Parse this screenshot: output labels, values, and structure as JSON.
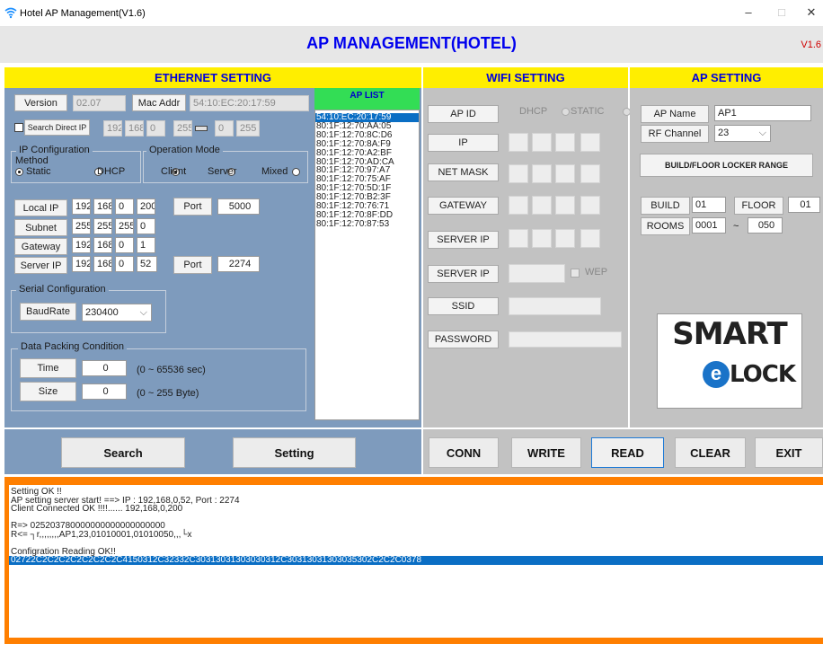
{
  "window": {
    "title": "Hotel AP Management(V1.6)",
    "minimize": "–",
    "maximize": "□",
    "close": "✕"
  },
  "header": {
    "title": "AP MANAGEMENT(HOTEL)",
    "version": "V1.6"
  },
  "ethernet": {
    "heading": "ETHERNET SETTING",
    "version_label": "Version",
    "version_value": "02.07",
    "mac_label": "Mac Addr",
    "mac_value": "54:10:EC:20:17:59",
    "search_direct_ip_label": "Search Direct IP",
    "direct_ip": [
      "192",
      "168",
      "0",
      "255",
      "0",
      "255"
    ],
    "ip_config_group": "IP Configuration",
    "method_label": "Method",
    "method_static": "Static",
    "method_dhcp": "DHCP",
    "op_mode_group": "Operation Mode",
    "mode_client": "Client",
    "mode_server": "Server",
    "mode_mixed": "Mixed",
    "local_ip_label": "Local IP",
    "local_ip": [
      "192",
      "168",
      "0",
      "200"
    ],
    "port_label": "Port",
    "local_port": "5000",
    "subnet_label": "Subnet",
    "subnet": [
      "255",
      "255",
      "255",
      "0"
    ],
    "gateway_label": "Gateway",
    "gateway": [
      "192",
      "168",
      "0",
      "1"
    ],
    "server_ip_label": "Server IP",
    "server_ip": [
      "192",
      "168",
      "0",
      "52"
    ],
    "server_port_label": "Port",
    "server_port": "2274",
    "serial_group": "Serial Configuration",
    "baudrate_label": "BaudRate",
    "baudrate_value": "230400",
    "packing_group": "Data Packing Condition",
    "time_label": "Time",
    "time_value": "0",
    "time_range": "(0 ~ 65536 sec)",
    "size_label": "Size",
    "size_value": "0",
    "size_range": "(0 ~ 255 Byte)",
    "search_button": "Search",
    "setting_button": "Setting"
  },
  "ap_list": {
    "heading": "AP LIST",
    "items": [
      "54:10:EC:20:17:59",
      "80:1F:12:70:AA:05",
      "80:1F:12:70:8C:D6",
      "80:1F:12:70:8A:F9",
      "80:1F:12:70:A2:BF",
      "80:1F:12:70:AD:CA",
      "80:1F:12:70:97:A7",
      "80:1F:12:70:75:AF",
      "80:1F:12:70:5D:1F",
      "80:1F:12:70:B2:3F",
      "80:1F:12:70:76:71",
      "80:1F:12:70:8F:DD",
      "80:1F:12:70:87:53"
    ],
    "selected_index": 0
  },
  "wifi": {
    "heading": "WIFI SETTING",
    "ap_id_label": "AP ID",
    "dhcp_label": "DHCP",
    "static_label": "STATIC",
    "ip_label": "IP",
    "netmask_label": "NET MASK",
    "gateway_label": "GATEWAY",
    "server_ip_label": "SERVER IP",
    "server_ip2_label": "SERVER IP",
    "wep_label": "WEP",
    "ssid_label": "SSID",
    "password_label": "PASSWORD"
  },
  "ap": {
    "heading": "AP SETTING",
    "ap_name_label": "AP Name",
    "ap_name_value": "AP1",
    "rf_channel_label": "RF Channel",
    "rf_channel_value": "23",
    "locker_range_label": "BUILD/FLOOR LOCKER RANGE",
    "build_label": "BUILD",
    "build_value": "01",
    "floor_label": "FLOOR",
    "floor_value": "01",
    "rooms_label": "ROOMS",
    "rooms_from": "0001",
    "rooms_sep": "~",
    "rooms_to": "050",
    "logo_line1": "SMART",
    "logo_letter": "e",
    "logo_line2": "LOCK"
  },
  "actions": {
    "conn": "CONN",
    "write": "WRITE",
    "read": "READ",
    "clear": "CLEAR",
    "exit": "EXIT"
  },
  "log": {
    "lines": [
      "Setting OK !!",
      "AP setting server start! ==> IP : 192,168,0,52, Port : 2274",
      "Client Connected OK !!!!...... 192,168,0,200",
      "",
      "R=> 025203780000000000000000000",
      "R<= ┐r,,,,,,,,AP1,23,01010001,01010050,,,└x",
      "",
      "Configration Reading OK!!",
      "02722C2C2C2C2C2C2C2C4150312C32332C30313031303030312C30313031303035302C2C2C0378"
    ],
    "selected_index": 8
  },
  "colors": {
    "accent_blue": "#0000ee",
    "panel_yellow": "#ffee00",
    "ethernet_bg": "#7e9bbd",
    "log_border": "#ff7f00",
    "selection": "#0a6ec4"
  }
}
